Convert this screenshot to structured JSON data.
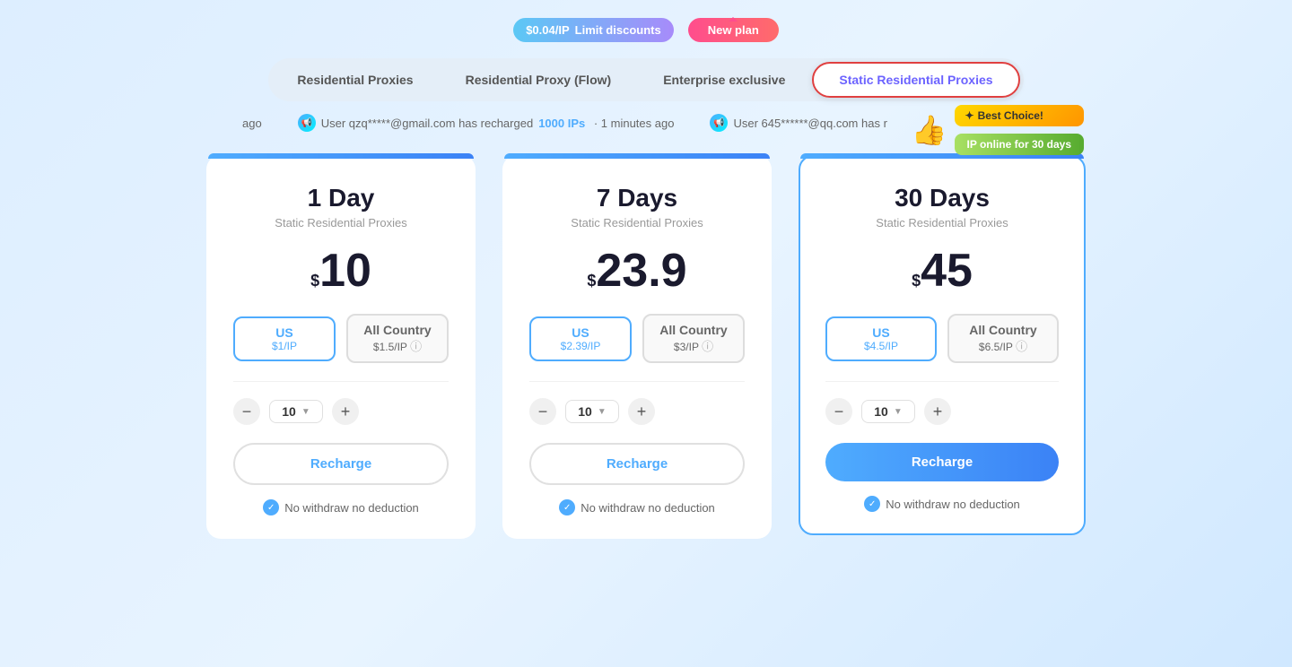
{
  "badges": {
    "discount_price": "$0.04/IP",
    "discount_label": "Limit discounts",
    "new_label": "New plan"
  },
  "tabs": [
    {
      "id": "residential",
      "label": "Residential Proxies",
      "active": false
    },
    {
      "id": "residential-flow",
      "label": "Residential Proxy (Flow)",
      "active": false
    },
    {
      "id": "enterprise",
      "label": "Enterprise exclusive",
      "active": false
    },
    {
      "id": "static-residential",
      "label": "Static Residential Proxies",
      "active": true
    }
  ],
  "notifications": [
    {
      "text": "ago",
      "highlight": "",
      "suffix": ""
    },
    {
      "text": "User qzq*****@gmail.com has recharged",
      "highlight": "1000 IPs",
      "suffix": "· 1 minutes ago"
    },
    {
      "text": "User 645******@qq.com has r",
      "highlight": "",
      "suffix": ""
    }
  ],
  "plans": [
    {
      "id": "1day",
      "title": "1 Day",
      "subtitle": "Static Residential Proxies",
      "price": "10",
      "featured": false,
      "regions": [
        {
          "name": "US",
          "price": "$1/IP",
          "active": true
        },
        {
          "name": "All Country",
          "price": "$1.5/IP",
          "active": false,
          "info": true
        }
      ],
      "qty": "10",
      "recharge_label": "Recharge",
      "no_withdraw": "No withdraw no deduction"
    },
    {
      "id": "7days",
      "title": "7 Days",
      "subtitle": "Static Residential Proxies",
      "price": "23.9",
      "featured": false,
      "regions": [
        {
          "name": "US",
          "price": "$2.39/IP",
          "active": true
        },
        {
          "name": "All Country",
          "price": "$3/IP",
          "active": false,
          "info": true
        }
      ],
      "qty": "10",
      "recharge_label": "Recharge",
      "no_withdraw": "No withdraw no deduction"
    },
    {
      "id": "30days",
      "title": "30 Days",
      "subtitle": "Static Residential Proxies",
      "price": "45",
      "featured": true,
      "best_choice": "Best Choice!",
      "ip_online": "IP online for 30 days",
      "regions": [
        {
          "name": "US",
          "price": "$4.5/IP",
          "active": true
        },
        {
          "name": "All Country",
          "price": "$6.5/IP",
          "active": false,
          "info": true
        }
      ],
      "qty": "10",
      "recharge_label": "Recharge",
      "no_withdraw": "No withdraw no deduction"
    }
  ]
}
